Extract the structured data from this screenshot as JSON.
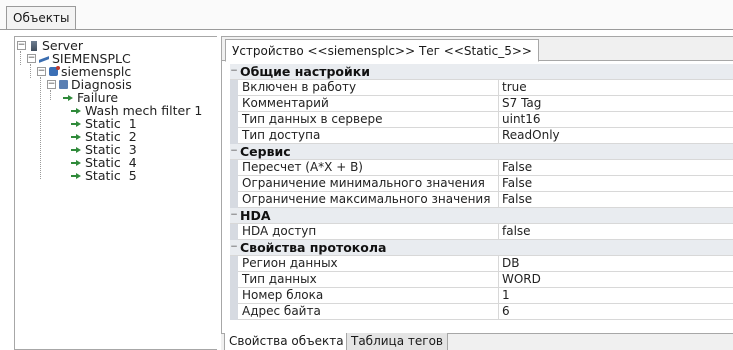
{
  "top_tab": {
    "label": "Объекты"
  },
  "tree": {
    "items": [
      {
        "label": "Server",
        "icon": "server-icon"
      },
      {
        "label": "SIEMENSPLC",
        "icon": "plc-channel-icon"
      },
      {
        "label": "siemensplc",
        "icon": "device-icon"
      },
      {
        "label": "Diagnosis",
        "icon": "diagnosis-group-icon"
      },
      {
        "label": "Failure",
        "icon": "tag-icon"
      },
      {
        "label": "Wash mech filter 1",
        "icon": "tag-icon"
      },
      {
        "label": "Static  1",
        "icon": "tag-icon"
      },
      {
        "label": "Static  2",
        "icon": "tag-icon"
      },
      {
        "label": "Static  3",
        "icon": "tag-icon"
      },
      {
        "label": "Static  4",
        "icon": "tag-icon"
      },
      {
        "label": "Static  5",
        "icon": "tag-icon"
      }
    ]
  },
  "doc_tab": {
    "label": "Устройство <<siemensplc>> Тег  <<Static_5>>"
  },
  "properties": {
    "general": {
      "title": "Общие настройки",
      "rows": [
        {
          "name": "Включен в работу",
          "value": "true"
        },
        {
          "name": "Комментарий",
          "value": "S7 Tag"
        },
        {
          "name": "Тип данных в сервере",
          "value": "uint16"
        },
        {
          "name": "Тип доступа",
          "value": "ReadOnly"
        }
      ]
    },
    "service": {
      "title": "Сервис",
      "rows": [
        {
          "name": "Пересчет (A*X + B)",
          "value": "False"
        },
        {
          "name": "Ограничение минимального значения",
          "value": "False"
        },
        {
          "name": "Ограничение максимального значения",
          "value": "False"
        }
      ]
    },
    "hda": {
      "title": "HDA",
      "rows": [
        {
          "name": "HDA доступ",
          "value": "false"
        }
      ]
    },
    "protocol": {
      "title": "Свойства протокола",
      "rows": [
        {
          "name": "Регион данных",
          "value": "DB"
        },
        {
          "name": "Тип данных",
          "value": "WORD"
        },
        {
          "name": "Номер блока",
          "value": "1"
        },
        {
          "name": "Адрес байта",
          "value": "6"
        }
      ]
    }
  },
  "bottom_tabs": {
    "object_properties": "Свойства объекта",
    "tag_table": "Таблица тегов"
  }
}
